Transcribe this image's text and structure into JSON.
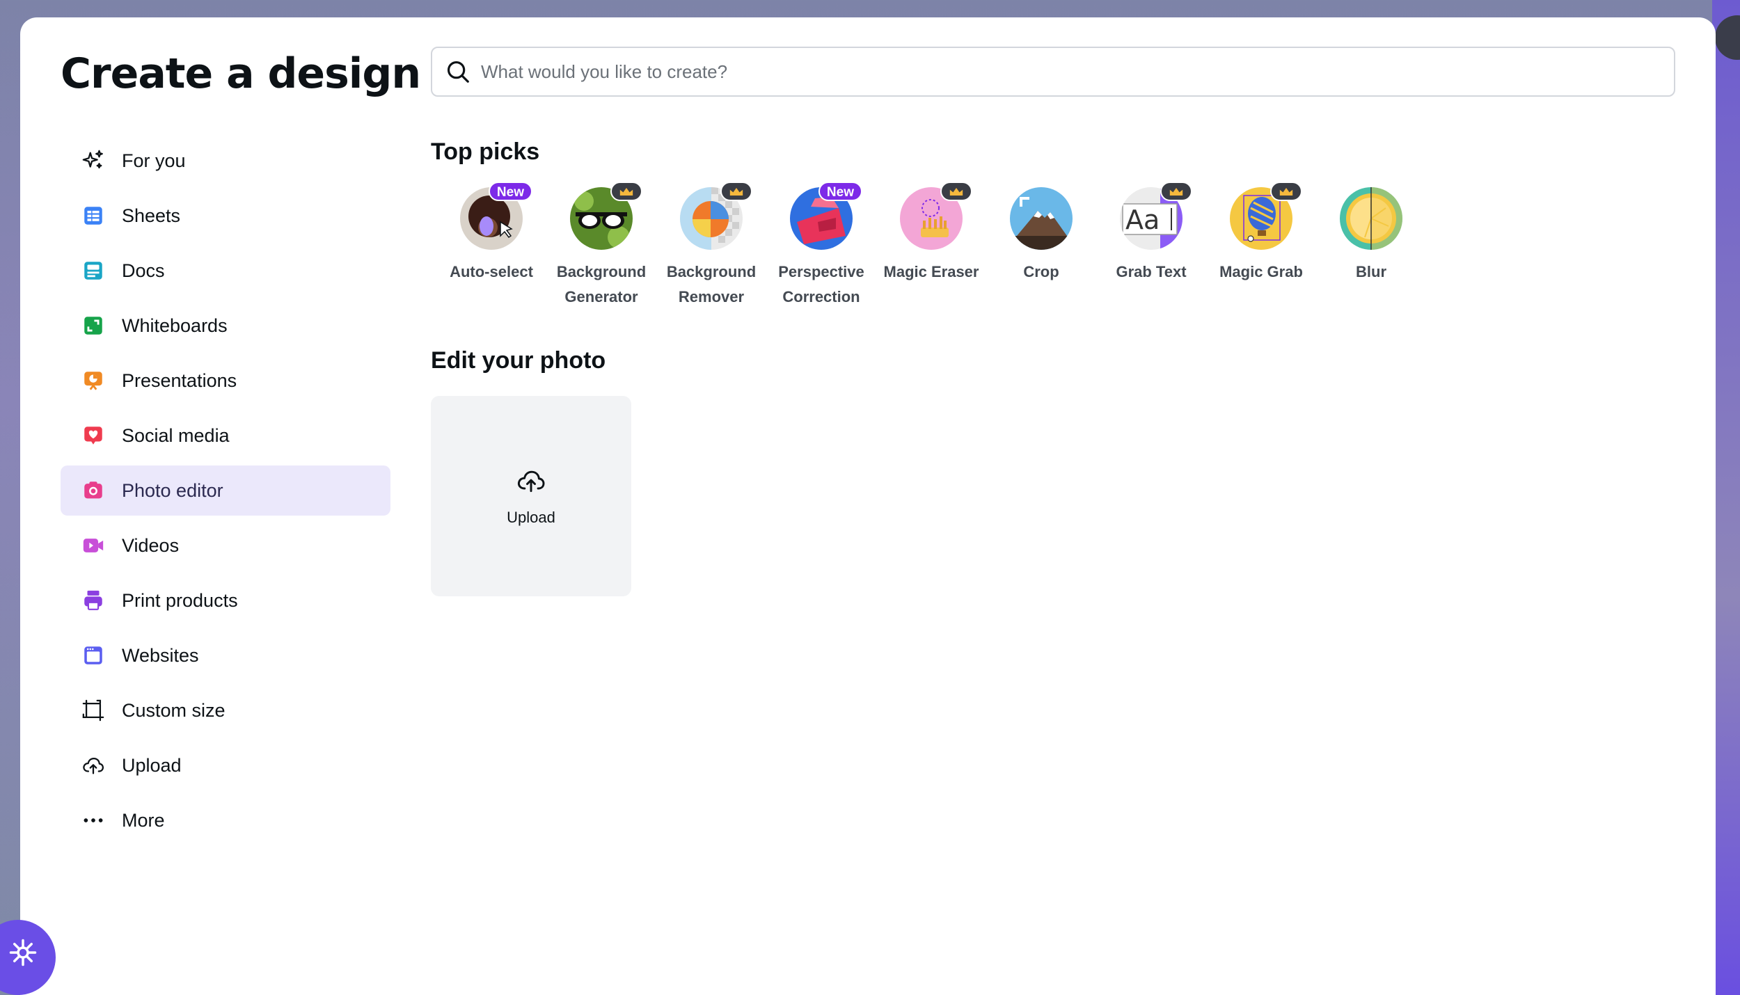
{
  "modal": {
    "title": "Create a design"
  },
  "search": {
    "placeholder": "What would you like to create?",
    "value": ""
  },
  "sidebar": {
    "items": [
      {
        "label": "For you",
        "icon": "sparkles-icon",
        "color": "#0d1216"
      },
      {
        "label": "Sheets",
        "icon": "sheets-icon",
        "color": "#3b82f6"
      },
      {
        "label": "Docs",
        "icon": "docs-icon",
        "color": "#1aa5c6"
      },
      {
        "label": "Whiteboards",
        "icon": "whiteboard-icon",
        "color": "#16a34a"
      },
      {
        "label": "Presentations",
        "icon": "presentation-icon",
        "color": "#f08a24"
      },
      {
        "label": "Social media",
        "icon": "heart-icon",
        "color": "#ef3b4f"
      },
      {
        "label": "Photo editor",
        "icon": "camera-icon",
        "color": "#e83e8c",
        "active": true
      },
      {
        "label": "Videos",
        "icon": "video-icon",
        "color": "#c84fd8"
      },
      {
        "label": "Print products",
        "icon": "printer-icon",
        "color": "#8b3fe0"
      },
      {
        "label": "Websites",
        "icon": "website-icon",
        "color": "#5b5ef0"
      },
      {
        "label": "Custom size",
        "icon": "custom-size-icon",
        "color": "#0d1216"
      },
      {
        "label": "Upload",
        "icon": "cloud-upload-icon",
        "color": "#0d1216"
      },
      {
        "label": "More",
        "icon": "more-dots-icon",
        "color": "#0d1216"
      }
    ]
  },
  "top_picks": {
    "title": "Top picks",
    "items": [
      {
        "label": "Auto-select",
        "badge": "New"
      },
      {
        "label": "Background Generator",
        "badge": "crown"
      },
      {
        "label": "Background Remover",
        "badge": "crown"
      },
      {
        "label": "Perspective Correction",
        "badge": "New"
      },
      {
        "label": "Magic Eraser",
        "badge": "crown"
      },
      {
        "label": "Crop",
        "badge": ""
      },
      {
        "label": "Grab Text",
        "badge": "crown"
      },
      {
        "label": "Magic Grab",
        "badge": "crown"
      },
      {
        "label": "Blur",
        "badge": ""
      }
    ]
  },
  "edit_photo": {
    "title": "Edit your photo",
    "upload_label": "Upload"
  },
  "colors": {
    "accent": "#7d2ae8",
    "active_bg": "#ebe8fb",
    "fab": "#6a4ee6"
  }
}
